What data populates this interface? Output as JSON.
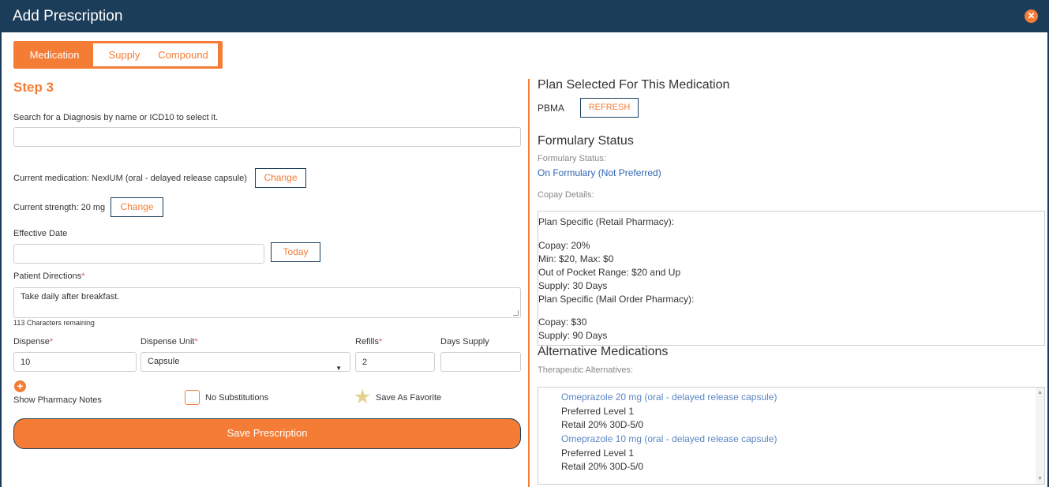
{
  "window": {
    "title": "Add Prescription"
  },
  "tabs": [
    {
      "label": "Medication",
      "active": true
    },
    {
      "label": "Supply",
      "active": false
    },
    {
      "label": "Compound",
      "active": false
    }
  ],
  "form": {
    "step_label": "Step 3",
    "diagnosis_label": "Search for a Diagnosis by name or ICD10 to select it.",
    "diagnosis_value": "",
    "current_medication": "Current medication: NexIUM (oral - delayed release capsule)",
    "change_label": "Change",
    "current_strength": "Current strength: 20 mg",
    "effective_date_label": "Effective Date",
    "effective_date_value": "",
    "today_label": "Today",
    "patient_directions_label": "Patient Directions",
    "required_mark": "*",
    "patient_directions_value": "Take daily after breakfast.",
    "chars_remaining": "113 Characters remaining",
    "dispense_label": "Dispense",
    "dispense_value": "10",
    "dispense_unit_label": "Dispense Unit",
    "dispense_unit_value": "Capsule",
    "refills_label": "Refills",
    "refills_value": "2",
    "days_supply_label": "Days Supply",
    "days_supply_value": "",
    "show_pharmacy_notes": "Show Pharmacy Notes",
    "no_substitutions": "No Substitutions",
    "save_favorite": "Save As Favorite",
    "save_prescription": "Save Prescription"
  },
  "plan": {
    "heading": "Plan Selected For This Medication",
    "name": "PBMA",
    "refresh_label": "REFRESH"
  },
  "formulary": {
    "heading": "Formulary Status",
    "status_label": "Formulary Status:",
    "status_value": "On Formulary",
    "status_detail": "(Not Preferred)",
    "copay_label": "Copay Details:",
    "copay_lines": [
      "Plan Specific (Retail Pharmacy):",
      "",
      "Copay: 20%",
      "Min: $20, Max: $0",
      "Out of Pocket Range: $20 and Up",
      "Supply: 30 Days",
      "Plan Specific (Mail Order Pharmacy):",
      "",
      "Copay: $30",
      "Supply: 90 Days"
    ]
  },
  "alternatives": {
    "heading": "Alternative Medications",
    "sub_label": "Therapeutic Alternatives:",
    "items": [
      {
        "name": "Omeprazole 20 mg (oral - delayed release capsule)",
        "level": "Preferred Level 1",
        "detail": "Retail 20% 30D-5/0"
      },
      {
        "name": "Omeprazole 10 mg (oral - delayed release capsule)",
        "level": "Preferred Level 1",
        "detail": "Retail 20% 30D-5/0"
      }
    ]
  },
  "colors": {
    "accent": "#f57c35",
    "navy": "#1c3d5a",
    "link": "#2f66b3"
  }
}
